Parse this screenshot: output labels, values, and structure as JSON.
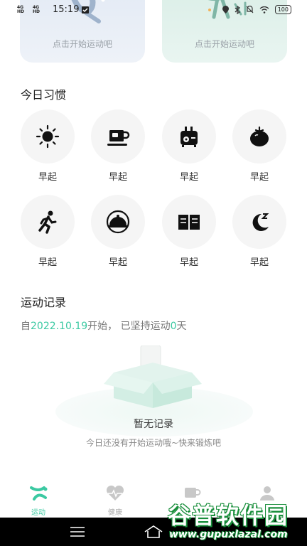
{
  "status_bar": {
    "network_1": "4G HD",
    "network_2": "4G HD",
    "time": "15:19",
    "battery": "100"
  },
  "cards": [
    {
      "hint": "点击开始运动吧"
    },
    {
      "hint": "点击开始运动吧"
    }
  ],
  "habits": {
    "title": "今日习惯",
    "items": [
      {
        "label": "早起",
        "icon": "sun-icon"
      },
      {
        "label": "早起",
        "icon": "coffee-cup-icon"
      },
      {
        "label": "早起",
        "icon": "toaster-icon"
      },
      {
        "label": "早起",
        "icon": "tomato-icon"
      },
      {
        "label": "早起",
        "icon": "running-icon"
      },
      {
        "label": "早起",
        "icon": "food-cloche-icon"
      },
      {
        "label": "早起",
        "icon": "book-icon"
      },
      {
        "label": "早起",
        "icon": "moon-sleep-icon"
      }
    ]
  },
  "records": {
    "title": "运动记录",
    "prefix": "自",
    "start_date": "2022.10.19",
    "middle": "开始，  已坚持运动",
    "days": "0",
    "suffix": "天",
    "empty_title": "暂无记录",
    "empty_subtitle": "今日还没有开始运动哦~快来锻炼吧"
  },
  "tabs": [
    {
      "label": "运动",
      "icon": "sport-icon",
      "active": true
    },
    {
      "label": "健康",
      "icon": "health-icon",
      "active": false
    },
    {
      "label": "",
      "icon": "cup-icon",
      "active": false
    },
    {
      "label": "",
      "icon": "user-icon",
      "active": false
    }
  ],
  "watermark": {
    "title": "谷普软件园",
    "url": "www.gupuxlazal.com"
  },
  "colors": {
    "accent": "#3bc9a2",
    "icon": "#111111"
  }
}
